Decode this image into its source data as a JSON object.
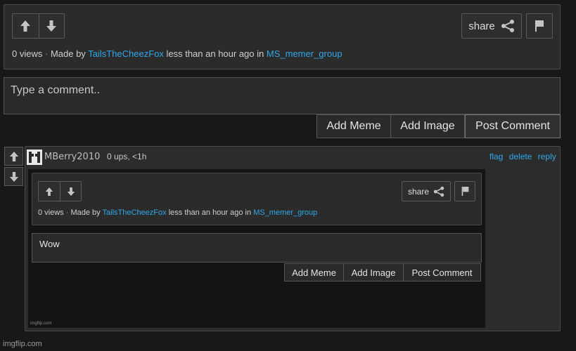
{
  "post": {
    "share_label": "share",
    "views": "0 views",
    "made_by": "Made by",
    "author": "TailsTheCheezFox",
    "time_in": "less than an hour ago in",
    "stream": "MS_memer_group"
  },
  "comment_form": {
    "placeholder": "Type a comment..",
    "add_meme": "Add Meme",
    "add_image": "Add Image",
    "post_comment": "Post Comment"
  },
  "comment": {
    "username": "MBerry2010",
    "stats": "0 ups, <1h",
    "actions": {
      "flag": "flag",
      "delete": "delete",
      "reply": "reply"
    }
  },
  "embedded": {
    "share_label": "share",
    "views": "0 views",
    "made_by": "Made by",
    "author": "TailsTheCheezFox",
    "time_in": "less than an hour ago in",
    "stream": "MS_memer_group",
    "comment_text": "Wow",
    "add_meme": "Add Meme",
    "add_image": "Add Image",
    "post_comment": "Post Comment",
    "watermark": "imgflip.com"
  },
  "footer_watermark": "imgflip.com"
}
